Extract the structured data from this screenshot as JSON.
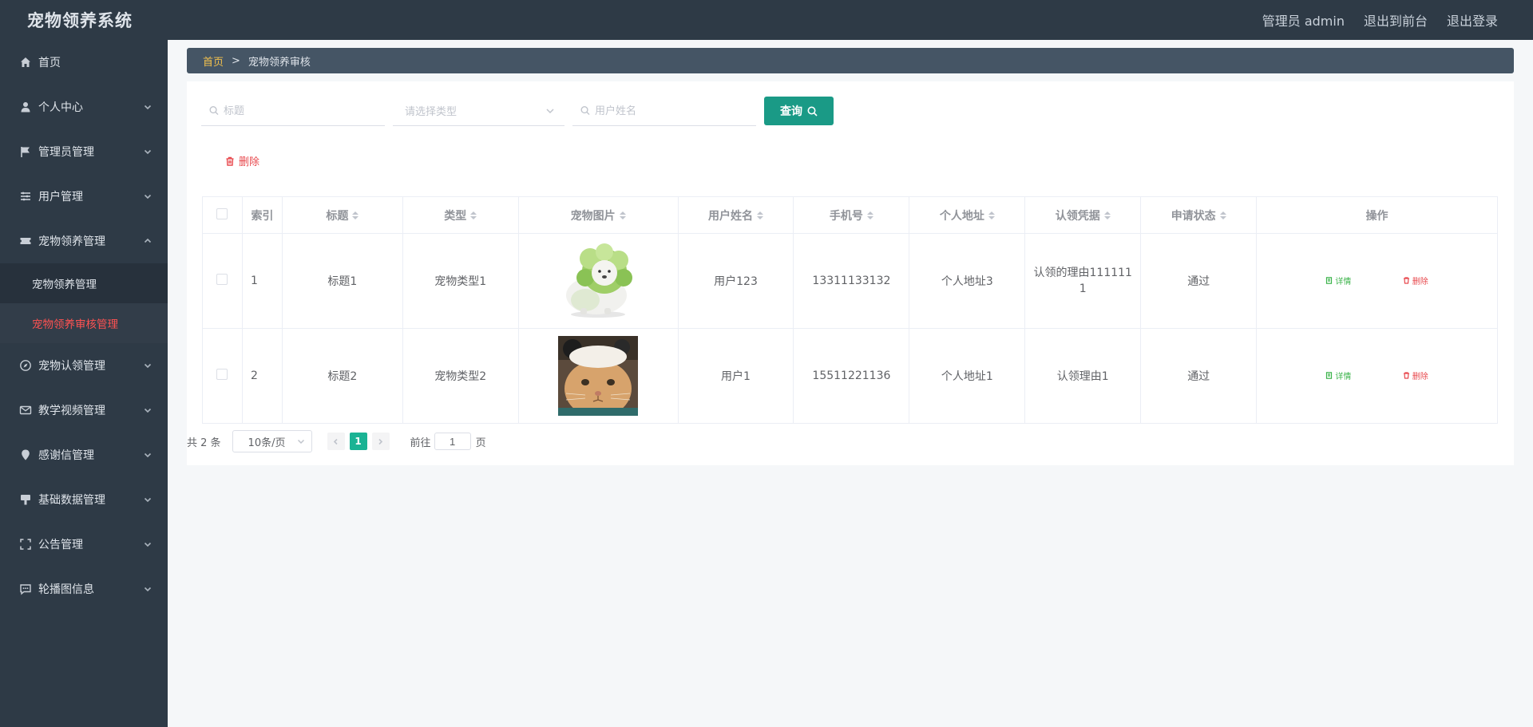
{
  "header": {
    "brand": "宠物领养系统",
    "admin_label": "管理员 admin",
    "front_label": "退出到前台",
    "logout_label": "退出登录"
  },
  "sidebar": {
    "items": [
      {
        "label": "首页",
        "icon": "home-icon"
      },
      {
        "label": "个人中心",
        "icon": "user-icon"
      },
      {
        "label": "管理员管理",
        "icon": "flag-icon"
      },
      {
        "label": "用户管理",
        "icon": "list-icon"
      },
      {
        "label": "宠物领养管理",
        "icon": "ticket-icon"
      },
      {
        "label": "宠物认领管理",
        "icon": "compass-icon"
      },
      {
        "label": "教学视频管理",
        "icon": "mail-icon"
      },
      {
        "label": "感谢信管理",
        "icon": "location-icon"
      },
      {
        "label": "基础数据管理",
        "icon": "brush-icon"
      },
      {
        "label": "公告管理",
        "icon": "fullscreen-icon"
      },
      {
        "label": "轮播图信息",
        "icon": "chat-icon"
      }
    ],
    "submenu": [
      {
        "label": "宠物领养管理"
      },
      {
        "label": "宠物领养审核管理"
      }
    ]
  },
  "breadcrumb": {
    "home": "首页",
    "sep": ">",
    "current": "宠物领养审核"
  },
  "search": {
    "title_placeholder": "标题",
    "type_placeholder": "请选择类型",
    "name_placeholder": "用户姓名",
    "query_label": "查询"
  },
  "actions": {
    "delete_label": "删除"
  },
  "table": {
    "headers": {
      "index": "索引",
      "title": "标题",
      "type": "类型",
      "image": "宠物图片",
      "username": "用户姓名",
      "phone": "手机号",
      "address": "个人地址",
      "proof": "认领凭据",
      "status": "申请状态",
      "ops": "操作"
    },
    "rows": [
      {
        "index": "1",
        "title": "标题1",
        "type": "宠物类型1",
        "username": "用户123",
        "phone": "13311133132",
        "address": "个人地址3",
        "proof": "认领的理由1111111",
        "status": "通过",
        "detail": "详情",
        "delete": "删除"
      },
      {
        "index": "2",
        "title": "标题2",
        "type": "宠物类型2",
        "username": "用户1",
        "phone": "15511221136",
        "address": "个人地址1",
        "proof": "认领理由1",
        "status": "通过",
        "detail": "详情",
        "delete": "删除"
      }
    ]
  },
  "pagination": {
    "total": "共 2 条",
    "page_size": "10条/页",
    "current_page": "1",
    "goto_label": "前往",
    "goto_value": "1",
    "page_suffix": "页"
  },
  "colors": {
    "sidebar_bg": "#2e3a46",
    "active_menu": "#ff5252",
    "primary_button": "#1a9a86",
    "breadcrumb_home": "#f3c14d"
  }
}
